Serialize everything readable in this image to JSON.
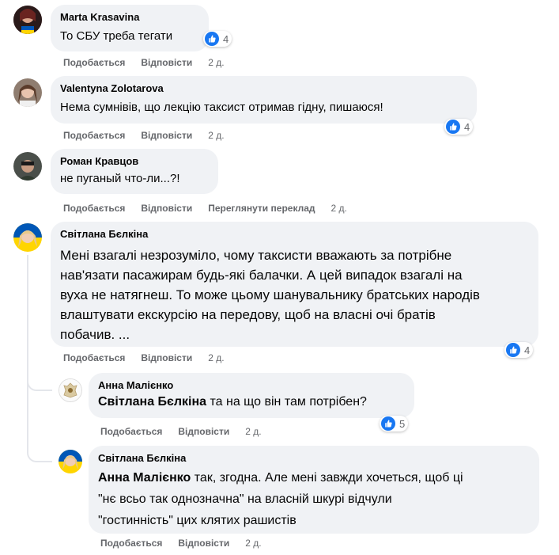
{
  "actions": {
    "like": "Подобається",
    "reply": "Відповісти",
    "translate": "Переглянути переклад"
  },
  "comments": [
    {
      "author": "Marta Krasavina",
      "text": "То СБУ треба тегати",
      "likes": "4",
      "time": "2 д."
    },
    {
      "author": "Valentyna Zolotarova",
      "text": "Нема сумнівів, що лекцію таксист отримав гідну, пишаюся!",
      "likes": "4",
      "time": "2 д."
    },
    {
      "author": "Роман Кравцов",
      "text": "не пуганый что-ли...?!",
      "time": "2 д."
    },
    {
      "author": "Світлана Бєлкіна",
      "lines": [
        "Мені взагалі незрозуміло, чому таксисти вважають за потрібне",
        "нав'язати пасажирам будь-які балачки. А цей випадок взагалі на",
        "вуха не натягнеш. То може цьому шанувальнику братських народів",
        "влаштувати екскурсію на передову, щоб на власні очі братів",
        "побачив. ..."
      ],
      "likes": "4",
      "time": "2 д."
    }
  ],
  "replies": [
    {
      "author": "Анна Малієнко",
      "tag": "Світлана Бєлкіна",
      "text": " та на що він там потрібен?",
      "likes": "5",
      "time": "2 д."
    },
    {
      "author": "Світлана Бєлкіна",
      "tag": "Анна Малієнко",
      "lines": [
        " так, згодна. Але мені завжди хочеться, щоб ці",
        "\"нє всьо так однозначна\" на власній шкурі відчули",
        "\"гостинність\" цих клятих рашистів"
      ],
      "time": "2 д."
    }
  ],
  "colors": {
    "bubble": "#f0f2f5",
    "like_blue": "#1877f2",
    "meta_gray": "#65676b"
  }
}
